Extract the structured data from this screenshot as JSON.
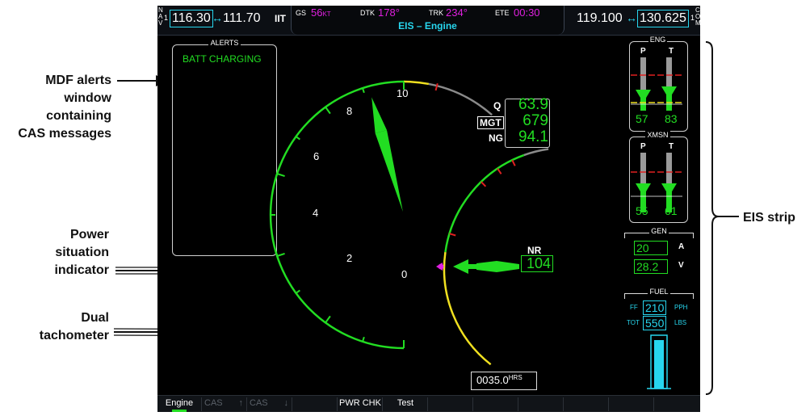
{
  "callouts": {
    "alerts": [
      "MDF alerts",
      "window",
      "containing",
      "CAS messages"
    ],
    "power": [
      "Power",
      "situation",
      "indicator"
    ],
    "tach": [
      "Dual",
      "tachometer"
    ],
    "eis": "EIS strip"
  },
  "nav": {
    "letters": [
      "N",
      "A",
      "V"
    ],
    "index": "1",
    "active": "116.30",
    "arrow": "↔",
    "standby": "111.70",
    "ident": "IIT"
  },
  "center": {
    "gs_label": "GS",
    "gs_value": "56",
    "gs_unit": "KT",
    "dtk_label": "DTK",
    "dtk_value": "178°",
    "trk_label": "TRK",
    "trk_value": "234°",
    "ete_label": "ETE",
    "ete_value": "00:30",
    "page_title": "EIS – Engine"
  },
  "com": {
    "active": "119.100",
    "arrow": "↔",
    "standby": "130.625",
    "letters": [
      "C",
      "O",
      "M"
    ],
    "index": "1"
  },
  "alerts_window": {
    "title": "ALERTS",
    "message": "BATT CHARGING"
  },
  "psi": {
    "labels": [
      "0",
      "2",
      "4",
      "6",
      "8",
      "10"
    ],
    "q_label": "Q",
    "q_value": "63.9",
    "mgt_label": "MGT",
    "mgt_value": "679",
    "ng_label": "NG",
    "ng_value": "94.1"
  },
  "tach": {
    "nr_label": "NR",
    "nr_value": "104"
  },
  "hours": {
    "value": "0035.0",
    "unit": "HRS"
  },
  "eis": {
    "eng_title": "ENG",
    "eng_p_label": "P",
    "eng_t_label": "T",
    "eng_p_value": "57",
    "eng_t_value": "83",
    "xmsn_title": "XMSN",
    "xmsn_p_label": "P",
    "xmsn_t_label": "T",
    "xmsn_p_value": "55",
    "xmsn_t_value": "61",
    "gen_title": "GEN",
    "gen_amps": "20",
    "gen_amps_unit": "A",
    "gen_volts": "28.2",
    "gen_volts_unit": "V",
    "fuel_title": "FUEL",
    "ff_label": "FF",
    "ff_value": "210",
    "ff_unit": "PPH",
    "tot_label": "TOT",
    "tot_value": "550",
    "tot_unit": "LBS"
  },
  "softkeys": [
    "Engine",
    "CAS",
    "↑",
    "CAS",
    "↓",
    "PWR CHK",
    "Test"
  ],
  "colors": {
    "green": "#22dd22",
    "cyan": "#27d6ee",
    "magenta": "#e020e0",
    "yellow": "#f0e020",
    "red": "#e02020"
  }
}
